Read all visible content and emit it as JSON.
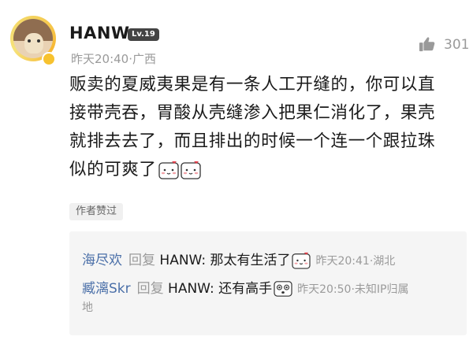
{
  "user": {
    "name": "HANW",
    "level": "Lv.19",
    "time": "昨天20:40",
    "location": "广西"
  },
  "likes": {
    "count": "301",
    "icon": "thumbs-up-icon"
  },
  "comment": {
    "lines": [
      "贩卖的夏威夷果是有一条人工开缝的，你可以直",
      "接带壳吞，胃酸从壳缝渗入把果仁消化了，果壳",
      "就排去去了，而且排出的时候一个连一个跟拉珠",
      "似的可爽了"
    ]
  },
  "author_tag": "作者赞过",
  "replies": [
    {
      "name": "海尽欢",
      "reply_label": "回复",
      "reply_to": "HANW:",
      "text": "那太有生活了",
      "time": "昨天20:41",
      "location": "湖北"
    },
    {
      "name": "臧漓Skr",
      "reply_label": "回复",
      "reply_to": "HANW:",
      "text": "还有高手",
      "time": "昨天20:50",
      "location_line1": "未知IP归属",
      "location_line2": "地"
    }
  ],
  "colors": {
    "username_link": "#4a6fa8",
    "meta_gray": "#9a9a9a",
    "reply_bg": "#f5f5f5"
  }
}
